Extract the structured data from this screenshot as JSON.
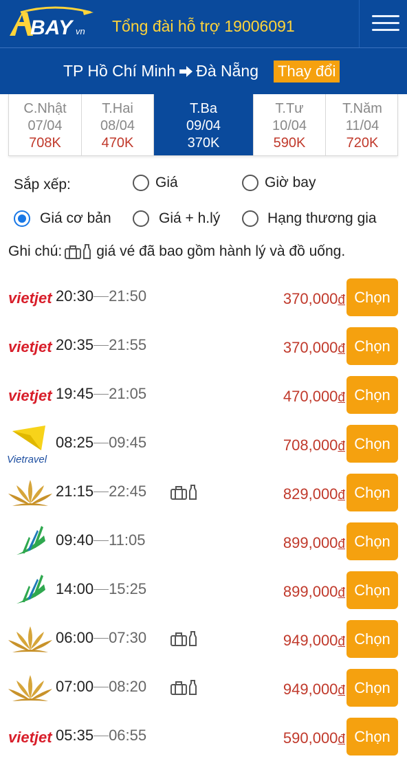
{
  "header": {
    "logo_text": "BAY",
    "logo_suffix": "vn",
    "hotline": "Tổng đài hỗ trợ 19006091",
    "menu_icon": "hamburger-menu-icon"
  },
  "route": {
    "from": "TP Hồ Chí Minh",
    "to": "Đà Nẵng",
    "arrow_icon": "arrow-right-icon",
    "change_label": "Thay đổi"
  },
  "dates": [
    {
      "day": "C.Nhật",
      "date": "07/04",
      "price": "708K",
      "active": false
    },
    {
      "day": "T.Hai",
      "date": "08/04",
      "price": "470K",
      "active": false
    },
    {
      "day": "T.Ba",
      "date": "09/04",
      "price": "370K",
      "active": true
    },
    {
      "day": "T.Tư",
      "date": "10/04",
      "price": "590K",
      "active": false
    },
    {
      "day": "T.Năm",
      "date": "11/04",
      "price": "720K",
      "active": false
    }
  ],
  "sort": {
    "label": "Sắp xếp:",
    "by_price": "Giá",
    "by_time": "Giờ bay",
    "basic_price": "Giá cơ bản",
    "price_luggage": "Giá + h.lý",
    "business": "Hạng thương gia",
    "selected": "Giá cơ bản"
  },
  "note": {
    "prefix": "Ghi chú:",
    "text": "giá vé đã bao gồm hành lý và đồ uống."
  },
  "colors": {
    "brand_blue": "#0a4a9c",
    "accent_orange": "#f5a10f",
    "price_red": "#c0392b",
    "hotline_yellow": "#ffd43a"
  },
  "flights": [
    {
      "airline": "vietjet",
      "dep": "20:30",
      "arr": "21:50",
      "price": "370,000",
      "currency": "đ",
      "included": false,
      "button": "Chọn"
    },
    {
      "airline": "vietjet",
      "dep": "20:35",
      "arr": "21:55",
      "price": "370,000",
      "currency": "đ",
      "included": false,
      "button": "Chọn"
    },
    {
      "airline": "vietjet",
      "dep": "19:45",
      "arr": "21:05",
      "price": "470,000",
      "currency": "đ",
      "included": false,
      "button": "Chọn"
    },
    {
      "airline": "vietravel",
      "airline_text": "Vietravel",
      "dep": "08:25",
      "arr": "09:45",
      "price": "708,000",
      "currency": "đ",
      "included": false,
      "button": "Chọn"
    },
    {
      "airline": "vietnam-airlines",
      "dep": "21:15",
      "arr": "22:45",
      "price": "829,000",
      "currency": "đ",
      "included": true,
      "button": "Chọn"
    },
    {
      "airline": "bamboo",
      "dep": "09:40",
      "arr": "11:05",
      "price": "899,000",
      "currency": "đ",
      "included": false,
      "button": "Chọn"
    },
    {
      "airline": "bamboo",
      "dep": "14:00",
      "arr": "15:25",
      "price": "899,000",
      "currency": "đ",
      "included": false,
      "button": "Chọn"
    },
    {
      "airline": "vietnam-airlines",
      "dep": "06:00",
      "arr": "07:30",
      "price": "949,000",
      "currency": "đ",
      "included": true,
      "button": "Chọn"
    },
    {
      "airline": "vietnam-airlines",
      "dep": "07:00",
      "arr": "08:20",
      "price": "949,000",
      "currency": "đ",
      "included": true,
      "button": "Chọn"
    },
    {
      "airline": "vietjet",
      "dep": "05:35",
      "arr": "06:55",
      "price": "590,000",
      "currency": "đ",
      "included": false,
      "button": "Chọn"
    }
  ]
}
